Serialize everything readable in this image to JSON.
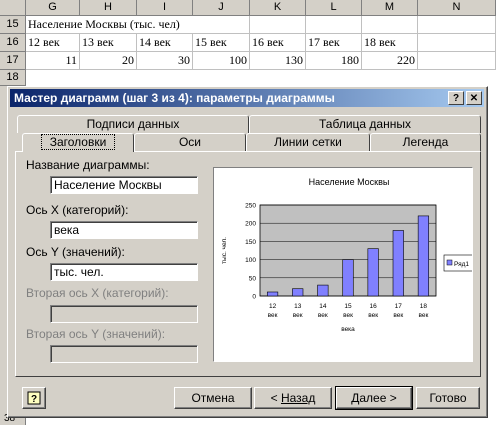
{
  "sheet": {
    "columns": [
      "G",
      "H",
      "I",
      "J",
      "K",
      "L",
      "M",
      "N"
    ],
    "rows": [
      {
        "num": "15",
        "cells": [
          "Население Москвы (тыс. чел)",
          "",
          "",
          "",
          "",
          "",
          "",
          ""
        ]
      },
      {
        "num": "16",
        "cells": [
          "12 век",
          "13 век",
          "14 век",
          "15 век",
          "16 век",
          "17 век",
          "18 век",
          ""
        ]
      },
      {
        "num": "17",
        "cells": [
          "11",
          "20",
          "30",
          "100",
          "130",
          "180",
          "220",
          ""
        ]
      },
      {
        "num": "18",
        "cells": [
          "",
          "",
          "",
          "",
          "",
          "",
          "",
          ""
        ]
      }
    ],
    "last_row_label": "38"
  },
  "dialog": {
    "title": "Мастер диаграмм (шаг 3 из 4): параметры диаграммы",
    "help_btn": "?",
    "close_btn": "✕",
    "tabs_back": [
      "Подписи данных",
      "Таблица данных"
    ],
    "tabs_front": [
      "Заголовки",
      "Оси",
      "Линии сетки",
      "Легенда"
    ],
    "active_tab": "Заголовки",
    "fields": {
      "chart_title_label": "Название диаграммы:",
      "chart_title_value": "Население Москвы",
      "x_axis_label": "Ось X (категорий):",
      "x_axis_value": "века",
      "y_axis_label": "Ось Y (значений):",
      "y_axis_value": "тыс. чел.",
      "x2_axis_label": "Вторая ось X (категорий):",
      "y2_axis_label": "Вторая ось Y (значений):"
    },
    "buttons": {
      "cancel": "Отмена",
      "back_prefix": "< ",
      "back": "Назад",
      "next": "Далее >",
      "finish": "Готово"
    }
  },
  "chart_data": {
    "type": "bar",
    "title": "Население Москвы",
    "xlabel": "века",
    "ylabel": "тыс. чел.",
    "categories": [
      "12 век",
      "13 век",
      "14 век",
      "15 век",
      "16 век",
      "17 век",
      "18 век"
    ],
    "series": [
      {
        "name": "Ряд1",
        "values": [
          11,
          20,
          30,
          100,
          130,
          180,
          220
        ]
      }
    ],
    "ylim": [
      0,
      250
    ],
    "yticks": [
      0,
      50,
      100,
      150,
      200,
      250
    ],
    "bar_color": "#8080ff",
    "grid": true,
    "legend": "right"
  }
}
